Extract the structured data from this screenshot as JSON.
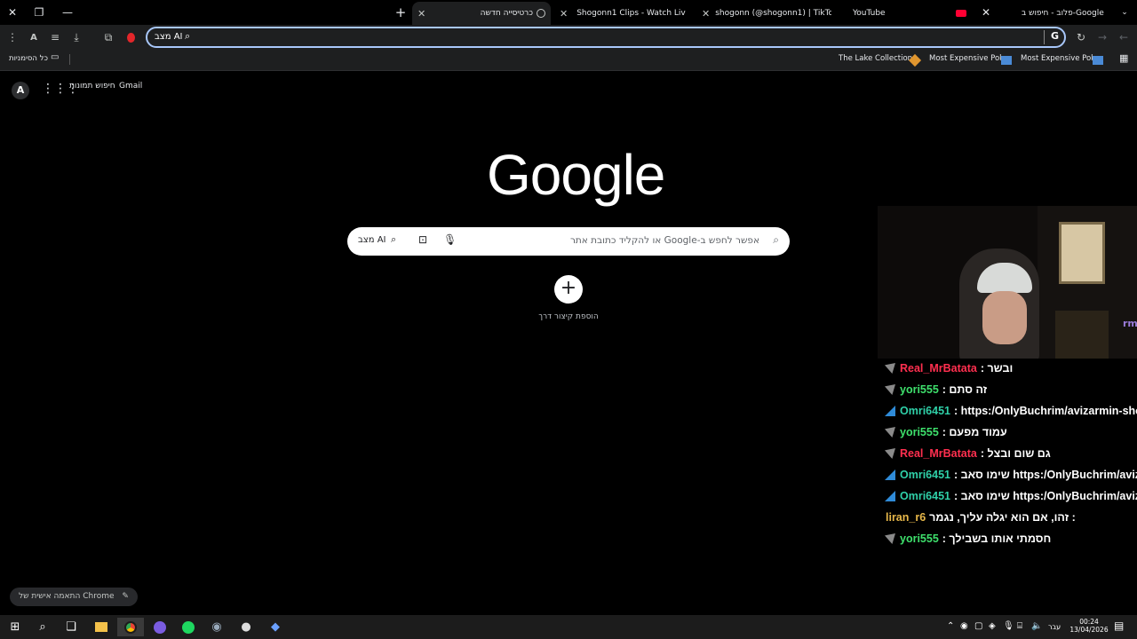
{
  "tabs": {
    "new_tab_plus": "+",
    "active": "כרטיסייה חדשה",
    "items": [
      "Shogonn1 Clips - Watch Liv",
      "shogonn (@shogonn1) | TikTok",
      "YouTube",
      "פלוב - חיפוש ב-Google"
    ]
  },
  "omnibox": {
    "value": "מצב AI"
  },
  "bookmarks": {
    "all": "כל הסימניות",
    "items": [
      "The Lake Collection...",
      "Most Expensive Pok...",
      "Most Expensive Pok..."
    ]
  },
  "topnav": {
    "gmail": "Gmail",
    "images": "חיפוש תמונות"
  },
  "google": {
    "logo": "Google",
    "search_placeholder": "אפשר לחפש ב-Google או להקליד כתובת אתר",
    "ai_mode": "מצב AI",
    "add_shortcut_icon": "+",
    "add_shortcut_label": "הוספת קיצור דרך",
    "customize": "התאמה אישית של Chrome"
  },
  "stream": {
    "overlay_text": "rm"
  },
  "chat": [
    {
      "user": "Real_MrBatata",
      "msg": ": ובשר",
      "color": "#ff2f4f",
      "badge": "gray"
    },
    {
      "user": "yori555",
      "msg": ": זה סתם",
      "color": "#3ee06c",
      "badge": "gray"
    },
    {
      "user": "Omri6451",
      "msg": ": https:/OnlyBuchrim/avizarmin-sho",
      "color": "#2fd0a8",
      "badge": "blue"
    },
    {
      "user": "yori555",
      "msg": ": עמוד מפעם",
      "color": "#3ee06c",
      "badge": "gray"
    },
    {
      "user": "Real_MrBatata",
      "msg": ": גם שום ובצל",
      "color": "#ff2f4f",
      "badge": "gray"
    },
    {
      "user": "Omri6451",
      "msg": ": שימו סאב https:/OnlyBuchrim/aviz",
      "color": "#2fd0a8",
      "badge": "blue"
    },
    {
      "user": "Omri6451",
      "msg": ": שימו סאב https:/OnlyBuchrim/aviz",
      "color": "#2fd0a8",
      "badge": "blue"
    },
    {
      "user": "liran_r6",
      "msg": "זהו, אם הוא יגלה עליך, נגמר :",
      "color": "#e8b84a",
      "badge": "none"
    },
    {
      "user": "yori555",
      "msg": ": חסמתי אותו בשבילך",
      "color": "#3ee06c",
      "badge": "gray"
    }
  ],
  "taskbar": {
    "lang": "עבר",
    "time": "00:24",
    "date": "13/04/2026"
  },
  "colors": {
    "accent": "#a8c7fa",
    "toolbar": "#1e1f20"
  }
}
